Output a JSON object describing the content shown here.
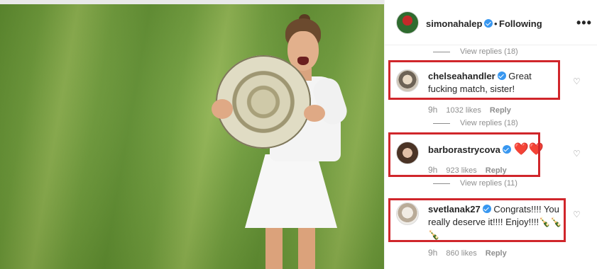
{
  "post": {
    "username": "simonahalep",
    "follow_status": "Following",
    "more_icon": "•••"
  },
  "view_replies": [
    {
      "label": "View replies (18)"
    },
    {
      "label": "View replies (18)"
    },
    {
      "label": "View replies (11)"
    }
  ],
  "comments": [
    {
      "username": "chelseahandler",
      "verified": true,
      "text": "Great fucking match, sister!",
      "time": "9h",
      "likes": "1032 likes",
      "reply_label": "Reply"
    },
    {
      "username": "barborastrycova",
      "verified": true,
      "text": "",
      "emoji": "❤️❤️",
      "time": "9h",
      "likes": "923 likes",
      "reply_label": "Reply"
    },
    {
      "username": "svetlanak27",
      "verified": true,
      "text": "Congrats!!!! You really deserve it!!!! Enjoy!!!!🍾🍾🍾",
      "time": "9h",
      "likes": "860 likes",
      "reply_label": "Reply"
    }
  ],
  "colors": {
    "highlight": "#d0262b",
    "verified": "#3897f0",
    "meta": "#8e8e8e"
  }
}
